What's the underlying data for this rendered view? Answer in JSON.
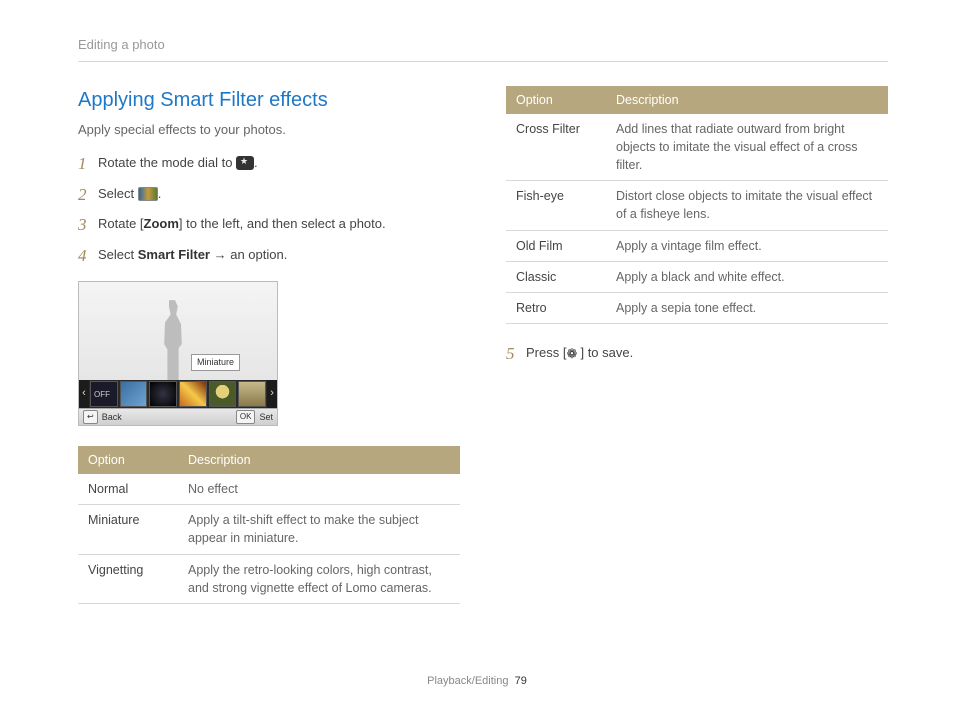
{
  "breadcrumb": "Editing a photo",
  "section": {
    "title": "Applying Smart Filter effects",
    "subtitle": "Apply special effects to your photos."
  },
  "steps": {
    "s1_pre": "Rotate the mode dial to ",
    "s1_post": ".",
    "s2_pre": "Select ",
    "s2_post": ".",
    "s3_pre": "Rotate [",
    "s3_zoom": "Zoom",
    "s3_post": "] to the left, and then select a photo.",
    "s4_pre": "Select ",
    "s4_bold": "Smart Filter",
    "s4_post": " → an option.",
    "s5_pre": "Press [",
    "s5_post": "] to save."
  },
  "shot": {
    "tooltip": "Miniature",
    "back_key": "↩",
    "back_label": "Back",
    "ok_key": "OK",
    "set_label": "Set"
  },
  "table_headers": {
    "option": "Option",
    "description": "Description"
  },
  "table1": [
    {
      "opt": "Normal",
      "desc": "No effect"
    },
    {
      "opt": "Miniature",
      "desc": "Apply a tilt-shift effect to make the subject appear in miniature."
    },
    {
      "opt": "Vignetting",
      "desc": "Apply the retro-looking colors, high contrast, and strong vignette effect of Lomo cameras."
    }
  ],
  "table2": [
    {
      "opt": "Cross Filter",
      "desc": "Add lines that radiate outward from bright objects to imitate the visual effect of a cross filter."
    },
    {
      "opt": "Fish-eye",
      "desc": "Distort close objects to imitate the visual effect of a fisheye lens."
    },
    {
      "opt": "Old Film",
      "desc": "Apply a vintage film effect."
    },
    {
      "opt": "Classic",
      "desc": "Apply a black and white effect."
    },
    {
      "opt": "Retro",
      "desc": "Apply a sepia tone effect."
    }
  ],
  "footer": {
    "section": "Playback/Editing",
    "page": "79"
  }
}
